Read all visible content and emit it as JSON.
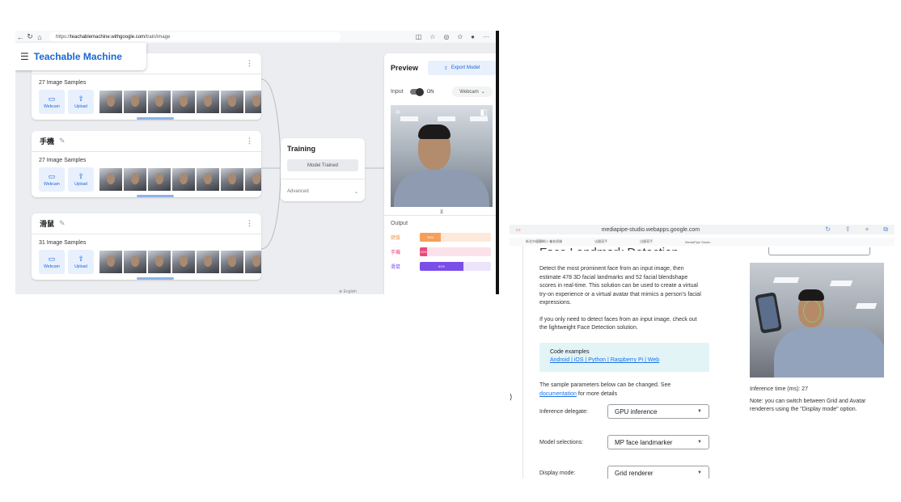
{
  "tm": {
    "url_domain": "teachablemachine.withgoogle.com",
    "url_path": "/train/image",
    "url_prefix": "https://",
    "app_title": "Teachable Machine",
    "classes": [
      {
        "name": "",
        "count_label": "27 Image Samples"
      },
      {
        "name": "手機",
        "count_label": "27 Image Samples"
      },
      {
        "name": "滑鼠",
        "count_label": "31 Image Samples"
      }
    ],
    "webcam_label": "Webcam",
    "upload_label": "Upload",
    "training": {
      "title": "Training",
      "button": "Model Trained",
      "advanced": "Advanced"
    },
    "preview": {
      "title": "Preview",
      "export_label": "Export Model",
      "input_label": "Input",
      "toggle_state": "ON",
      "source_select": "Webcam",
      "output_label": "Output",
      "outputs": [
        {
          "label": "鍵盤",
          "pct": 30,
          "pct_label": "30%",
          "color": "#f5a05a",
          "track": "#fde9d9"
        },
        {
          "label": "手機",
          "pct": 10,
          "pct_label": "10%",
          "color": "#e8497a",
          "track": "#fbe1e9"
        },
        {
          "label": "滑鼠",
          "pct": 61,
          "pct_label": "61%",
          "color": "#7a4ee8",
          "track": "#ebe4fb"
        }
      ]
    },
    "footer_lang": "English"
  },
  "mp": {
    "address": "mediapipe-studio.webapps.google.com",
    "bookmarks": [
      "新北市優購網小 養老保險",
      "出國寫手",
      "出國寫手",
      "MediaPipe Studio"
    ],
    "heading": "Face Landmark Detection",
    "intro": "Detect the most prominent face from an input image, then estimate 478 3D facial landmarks and 52 facial blendshape scores in real-time. This solution can be used to create a virtual try-on experience or a virtual avatar that mimics a person's facial expressions.",
    "detect_note": "If you only need to detect faces from an input image, check out the lightweight Face Detection solution.",
    "code_title": "Code examples",
    "code_links": "Android | iOS | Python | Raspberry Pi | Web",
    "sample_text": "The sample parameters below can be changed. See",
    "sample_link": "documentation",
    "sample_tail": "for more details",
    "fields": [
      {
        "label": "Inference delegate:",
        "value": "GPU inference"
      },
      {
        "label": "Model selections:",
        "value": "MP face landmarker"
      },
      {
        "label": "Display mode:",
        "value": "Grid renderer"
      }
    ],
    "inference_time": "Inference time (ms): 27",
    "note": "Note: you can switch between Grid and Avatar renderers using the \"Display mode\" option."
  }
}
